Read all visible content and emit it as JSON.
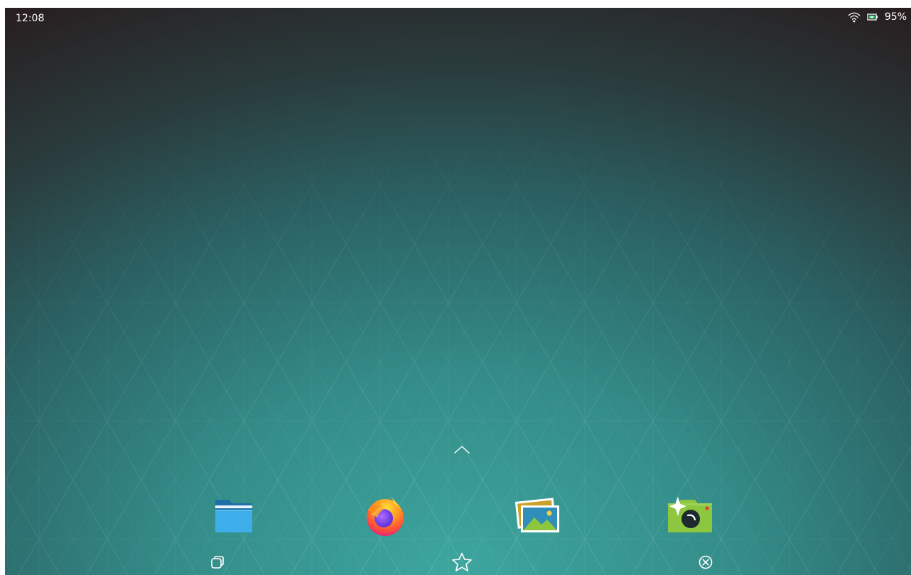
{
  "status_bar": {
    "time": "12:08",
    "battery_percent": "95%",
    "wifi_icon": "wifi-icon",
    "battery_icon": "battery-icon"
  },
  "drawer": {
    "icon": "chevron-up-icon"
  },
  "dock": {
    "apps": [
      {
        "name": "files",
        "icon": "folder-icon"
      },
      {
        "name": "firefox",
        "icon": "firefox-icon"
      },
      {
        "name": "gallery",
        "icon": "gallery-icon"
      },
      {
        "name": "camera",
        "icon": "camera-icon"
      }
    ]
  },
  "navigation": {
    "buttons": [
      {
        "name": "task-switcher",
        "icon": "overview-icon"
      },
      {
        "name": "home",
        "icon": "star-icon"
      },
      {
        "name": "close",
        "icon": "close-circle-icon"
      }
    ]
  },
  "colors": {
    "wallpaper_center": "#3da69f",
    "wallpaper_edge": "#27191b",
    "folder_blue": "#3daee9",
    "camera_green": "#8dc63f"
  }
}
